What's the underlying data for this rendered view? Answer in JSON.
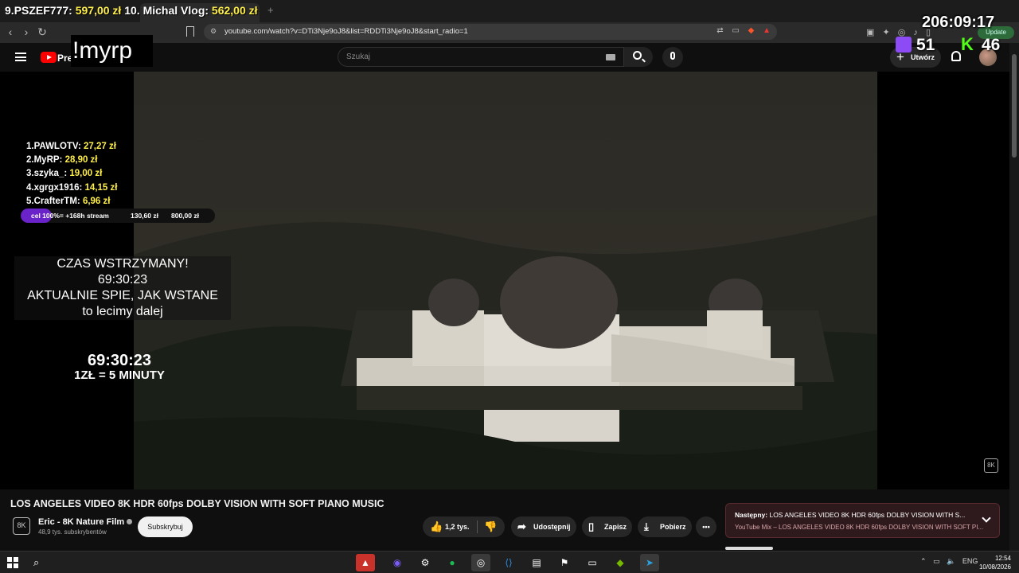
{
  "browser": {
    "url": "youtube.com/watch?v=DTi3Nje9oJ8&list=RDDTi3Nje9oJ8&start_radio=1",
    "new_tab": "+",
    "update_label": "Update"
  },
  "youtube": {
    "logo_text": "Pre",
    "search_placeholder": "Szukaj",
    "create_label": "Utwórz"
  },
  "overlay": {
    "top_donors": [
      {
        "rank": "9.",
        "name": "PSZEF777:",
        "amount": "597,00 zł"
      },
      {
        "rank": "10.",
        "name": "Michal Vlog:",
        "amount": "562,00 zł"
      }
    ],
    "command": "!myrp",
    "stream_timer": "206:09:17",
    "twitch_viewers": "51",
    "kick_viewers": "46",
    "leaderboard": [
      {
        "name": "1.PAWLOTV:",
        "amount": "27,27 zł"
      },
      {
        "name": "2.MyRP:",
        "amount": "28,90 zł"
      },
      {
        "name": "3.szyka_:",
        "amount": "19,00 zł"
      },
      {
        "name": "4.xgrgx1916:",
        "amount": "14,15 zł"
      },
      {
        "name": "5.CrafterTM:",
        "amount": "6,96 zł"
      }
    ],
    "goal": {
      "label": "cel 100%= +168h stream",
      "current": "130,60 zł",
      "target": "800,00 zł",
      "progress": 0.16
    },
    "pause": {
      "line1": "CZAS WSTRZYMANY!",
      "line2": "69:30:23",
      "line3": "AKTUALNIE SPIE, JAK WSTANE",
      "line4": "to lecimy dalej"
    },
    "countdown": "69:30:23",
    "rate": "1ZŁ = 5 MINUTY"
  },
  "video": {
    "title": "LOS ANGELES VIDEO 8K HDR 60fps DOLBY VISION WITH SOFT PIANO MUSIC",
    "channel": "Eric - 8K Nature Film",
    "subscribers": "48,9 tys. subskrybentów",
    "subscribe_label": "Subskrybuj",
    "likes": "1,2 tys.",
    "share_label": "Udostępnij",
    "save_label": "Zapisz",
    "download_label": "Pobierz",
    "more_label": "•••"
  },
  "next_up": {
    "prefix": "Następny:",
    "title": "LOS ANGELES VIDEO 8K HDR 60fps DOLBY VISION WITH S...",
    "subtitle": "YouTube Mix – LOS ANGELES VIDEO 8K HDR 60fps DOLBY VISION WITH SOFT PI..."
  },
  "taskbar": {
    "language": "ENG",
    "time": "12:54",
    "date": "10/08/2026"
  }
}
